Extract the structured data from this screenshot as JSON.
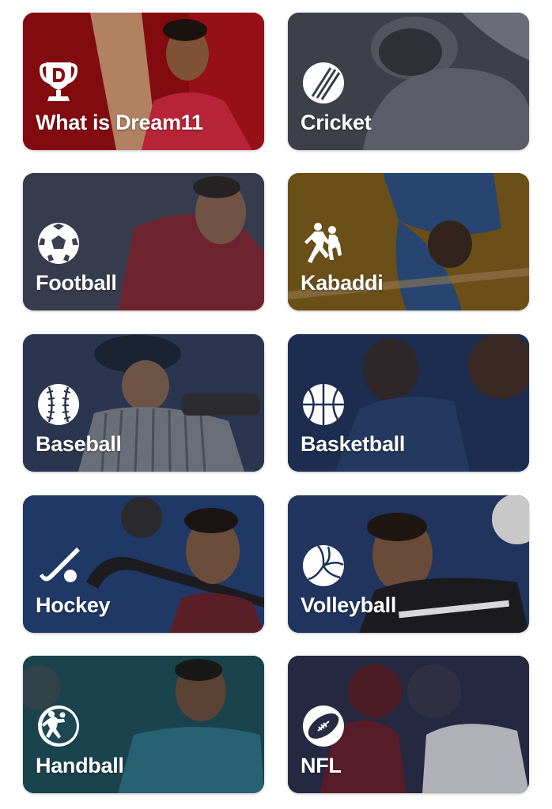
{
  "tiles": [
    {
      "label": "What is Dream11",
      "icon": "dream11-trophy-icon",
      "bg": "#8e0d12"
    },
    {
      "label": "Cricket",
      "icon": "cricket-ball-icon",
      "bg": "#3a3c46"
    },
    {
      "label": "Football",
      "icon": "football-icon",
      "bg": "#3a3f52"
    },
    {
      "label": "Kabaddi",
      "icon": "kabaddi-players-icon",
      "bg": "#6e4f14"
    },
    {
      "label": "Baseball",
      "icon": "baseball-icon",
      "bg": "#283449"
    },
    {
      "label": "Basketball",
      "icon": "basketball-icon",
      "bg": "#1f3152"
    },
    {
      "label": "Hockey",
      "icon": "hockey-stick-icon",
      "bg": "#1d3560"
    },
    {
      "label": "Volleyball",
      "icon": "volleyball-icon",
      "bg": "#1d3158"
    },
    {
      "label": "Handball",
      "icon": "handball-player-icon",
      "bg": "#1d4752"
    },
    {
      "label": "NFL",
      "icon": "american-football-icon",
      "bg": "#262a42"
    }
  ]
}
